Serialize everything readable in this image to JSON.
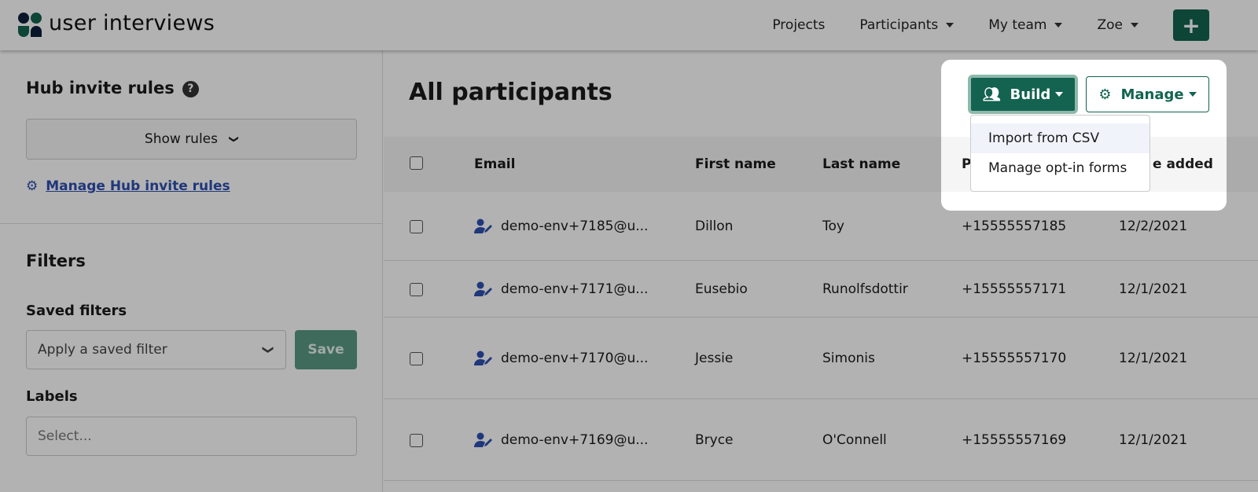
{
  "nav": {
    "brand": "user interviews",
    "links": [
      {
        "label": "Projects"
      },
      {
        "label": "Participants"
      },
      {
        "label": "My team"
      },
      {
        "label": "Zoe"
      }
    ],
    "add_label": "+",
    "accent": "#136350"
  },
  "sidebar": {
    "hub_title": "Hub invite rules",
    "help": "?",
    "show_rules": "Show rules",
    "manage_rules": "Manage Hub invite rules",
    "filters_title": "Filters",
    "saved_filters_label": "Saved filters",
    "saved_filter_placeholder": "Apply a saved filter",
    "save_label": "Save",
    "labels_label": "Labels",
    "labels_placeholder": "Select..."
  },
  "main": {
    "title": "All participants",
    "build_label": "Build",
    "manage_label": "Manage",
    "build_menu": [
      "Import from CSV",
      "Manage opt-in forms"
    ],
    "columns": [
      "Email",
      "First name",
      "Last name",
      "P",
      "e added"
    ],
    "rows": [
      {
        "email": "demo-env+7185@u...",
        "first": "Dillon",
        "last": "Toy",
        "phone": "+15555557185",
        "date": "12/2/2021"
      },
      {
        "email": "demo-env+7171@u...",
        "first": "Eusebio",
        "last": "Runolfsdottir",
        "phone": "+15555557171",
        "date": "12/1/2021"
      },
      {
        "email": "demo-env+7170@u...",
        "first": "Jessie",
        "last": "Simonis",
        "phone": "+15555557170",
        "date": "12/1/2021"
      },
      {
        "email": "demo-env+7169@u...",
        "first": "Bryce",
        "last": "O'Connell",
        "phone": "+15555557169",
        "date": "12/1/2021"
      }
    ]
  }
}
